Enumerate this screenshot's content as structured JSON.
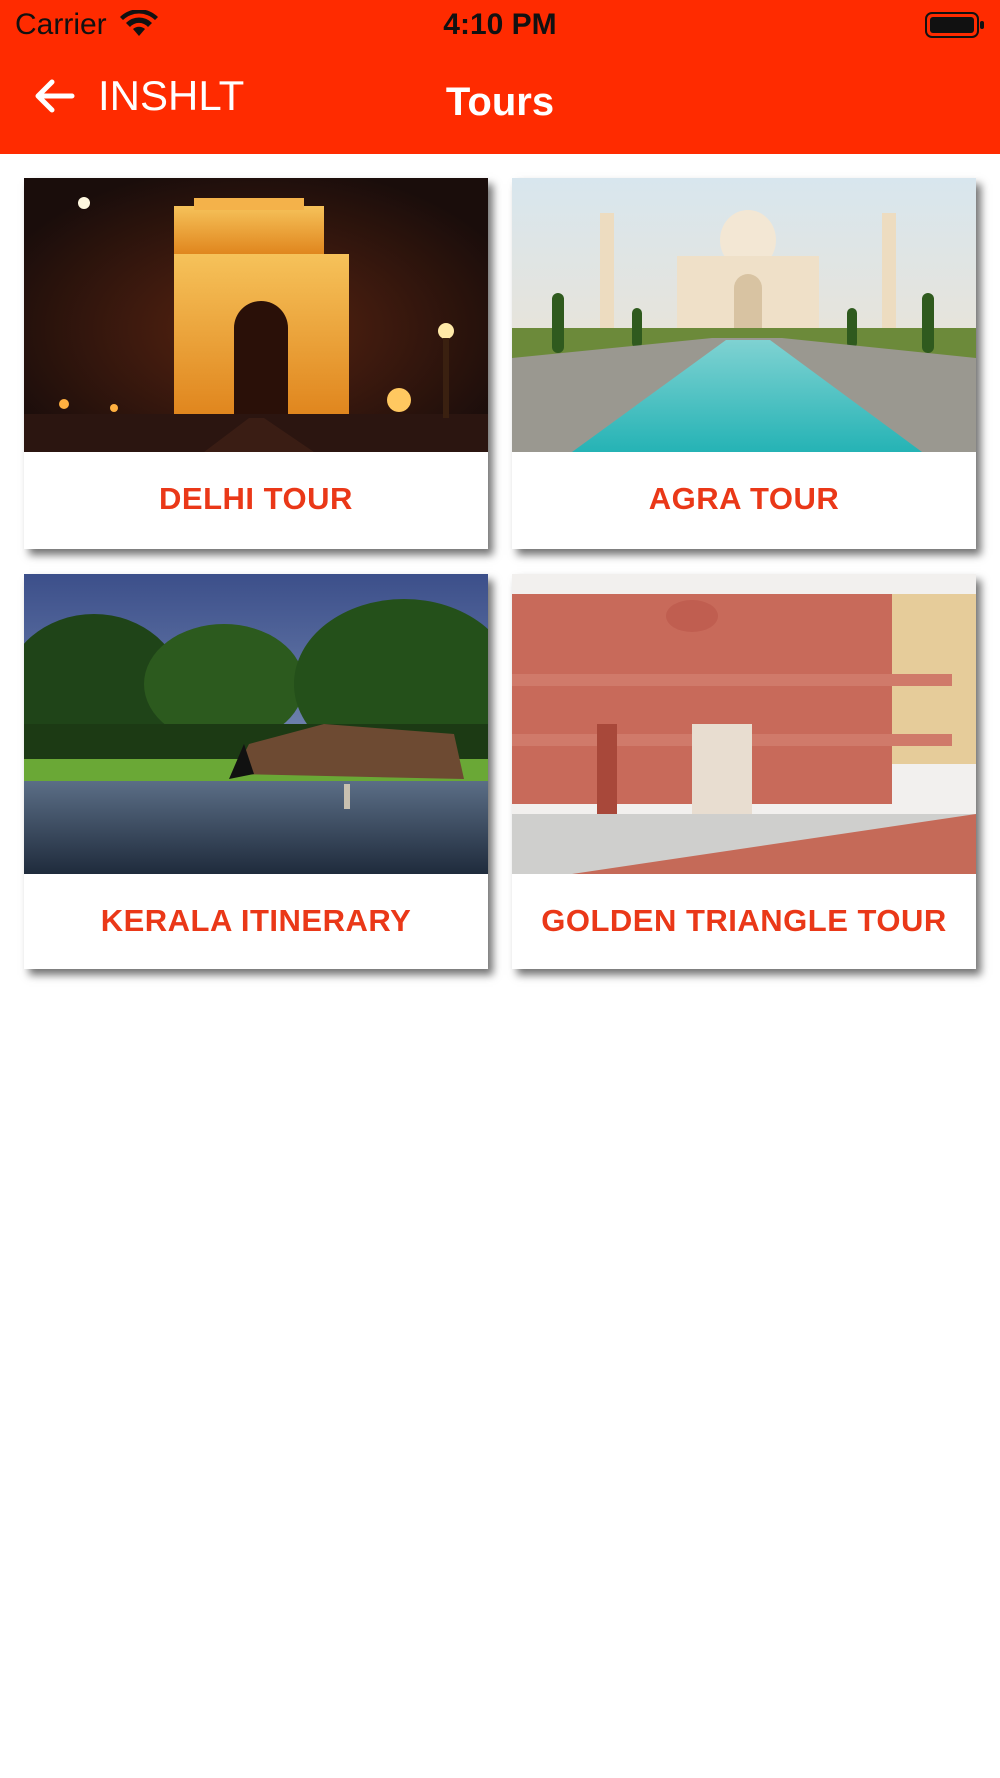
{
  "status_bar": {
    "carrier": "Carrier",
    "time": "4:10 PM",
    "icons": [
      "wifi-icon",
      "battery-icon"
    ]
  },
  "nav": {
    "back_label": "INSHLT",
    "title": "Tours",
    "back_icon": "arrow-left-icon"
  },
  "tours": [
    {
      "label": "DELHI TOUR",
      "image": "india-gate-night-photo"
    },
    {
      "label": "AGRA TOUR",
      "image": "taj-mahal-photo"
    },
    {
      "label": "KERALA ITINERARY",
      "image": "kerala-houseboat-photo"
    },
    {
      "label": "GOLDEN TRIANGLE TOUR",
      "image": "jaipur-city-palace-photo"
    }
  ],
  "colors": {
    "app_bar": "#ff2b00",
    "card_label": "#ea3818",
    "background": "#ffffff"
  }
}
